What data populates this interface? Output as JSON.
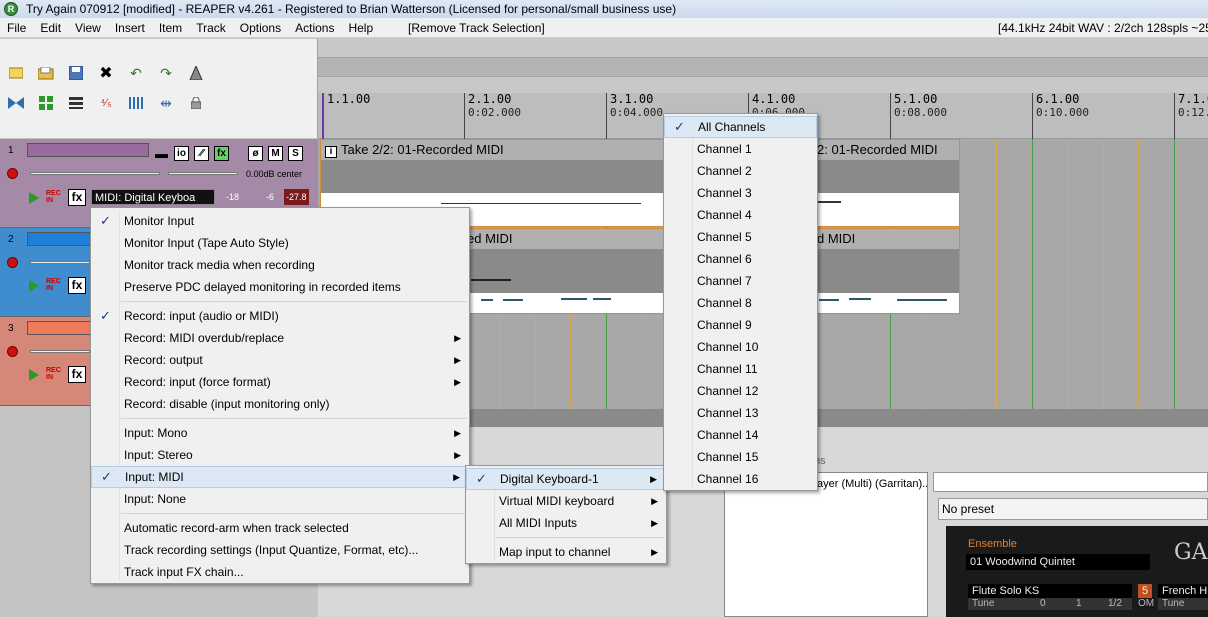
{
  "window": {
    "title": "Try Again 070912 [modified] - REAPER v4.261 - Registered to Brian Watterson (Licensed for personal/small business use)"
  },
  "menubar": {
    "items": [
      "File",
      "Edit",
      "View",
      "Insert",
      "Item",
      "Track",
      "Options",
      "Actions",
      "Help"
    ],
    "last_action": "[Remove Track Selection]",
    "status": "[44.1kHz 24bit WAV : 2/2ch 128spls ~25/"
  },
  "toolbar": {
    "icons": [
      "new-project-icon",
      "open-project-icon",
      "save-icon",
      "project-settings-icon",
      "undo-icon",
      "redo-icon",
      "metronome-icon",
      "ripple-icon",
      "grid-icon",
      "envelope-icon",
      "item-lock-icon",
      "snap-icon",
      "split-icon",
      "lock-icon"
    ]
  },
  "ruler": {
    "marks": [
      {
        "bar": "1.1.00",
        "time": ""
      },
      {
        "bar": "2.1.00",
        "time": "0:02.000"
      },
      {
        "bar": "3.1.00",
        "time": "0:04.000"
      },
      {
        "bar": "4.1.00",
        "time": "0:06.000"
      },
      {
        "bar": "5.1.00",
        "time": "0:08.000"
      },
      {
        "bar": "6.1.00",
        "time": "0:10.000"
      },
      {
        "bar": "7.1.0",
        "time": "0:12.0"
      }
    ]
  },
  "tracks": [
    {
      "number": "1",
      "color": "#a58aa8",
      "name_color": "#9a6c9e",
      "pan_label": "0.00dB center",
      "input": "MIDI: Digital Keyboa",
      "meter": [
        "-18",
        "-6",
        "-27.8"
      ]
    },
    {
      "number": "2",
      "color": "#3f8ccf",
      "name_color": "#1e7fd8"
    },
    {
      "number": "3",
      "color": "#d68878",
      "name_color": "#f07a5c"
    }
  ],
  "track_buttons": {
    "mute": "M",
    "solo": "S",
    "phase": "ø",
    "io": "io",
    "env": "⁄⁄",
    "fx": "fx",
    "rec_in": "REC\nIN"
  },
  "items": {
    "take_title": "Take 2/2: 01-Recorded MIDI",
    "take_title_right": "2: 01-Recorded MIDI",
    "track2_label_left": "ed MIDI",
    "track2_label_right": "d MIDI"
  },
  "track_menu": {
    "items": [
      {
        "label": "Monitor Input",
        "checked": true
      },
      {
        "label": "Monitor Input (Tape Auto Style)"
      },
      {
        "label": "Monitor track media when recording"
      },
      {
        "label": "Preserve PDC delayed monitoring in recorded items"
      },
      {
        "sep": true
      },
      {
        "label": "Record: input (audio or MIDI)",
        "checked": true
      },
      {
        "label": "Record: MIDI overdub/replace",
        "submenu": true
      },
      {
        "label": "Record: output",
        "submenu": true
      },
      {
        "label": "Record: input (force format)",
        "submenu": true
      },
      {
        "label": "Record: disable (input monitoring only)"
      },
      {
        "sep": true
      },
      {
        "label": "Input: Mono",
        "submenu": true
      },
      {
        "label": "Input: Stereo",
        "submenu": true
      },
      {
        "label": "Input: MIDI",
        "submenu": true,
        "checked": true,
        "highlight": true
      },
      {
        "label": "Input: None"
      },
      {
        "sep": true
      },
      {
        "label": "Automatic record-arm when track selected"
      },
      {
        "label": "Track recording settings (Input Quantize, Format, etc)..."
      },
      {
        "label": "Track input FX chain..."
      }
    ]
  },
  "midi_menu": {
    "items": [
      {
        "label": "Digital Keyboard-1",
        "submenu": true,
        "checked": true,
        "highlight": true
      },
      {
        "label": "Virtual MIDI keyboard",
        "submenu": true
      },
      {
        "label": "All MIDI Inputs",
        "submenu": true
      },
      {
        "sep": true
      },
      {
        "label": "Map input to channel",
        "submenu": true
      }
    ]
  },
  "channel_menu": {
    "items": [
      {
        "label": "All Channels",
        "checked": true,
        "highlight": true
      },
      {
        "label": "Channel 1"
      },
      {
        "label": "Channel 2"
      },
      {
        "label": "Channel 3"
      },
      {
        "label": "Channel 4"
      },
      {
        "label": "Channel 5"
      },
      {
        "label": "Channel 6"
      },
      {
        "label": "Channel 7"
      },
      {
        "label": "Channel 8"
      },
      {
        "label": "Channel 9"
      },
      {
        "label": "Channel 10"
      },
      {
        "label": "Channel 11"
      },
      {
        "label": "Channel 12"
      },
      {
        "label": "Channel 13"
      },
      {
        "label": "Channel 14"
      },
      {
        "label": "Channel 15"
      },
      {
        "label": "Channel 16"
      }
    ]
  },
  "fx_window": {
    "tab_fragment": "ns",
    "plugin": "ayer (Multi) (Garritan)...",
    "preset": "No preset",
    "ensemble_label": "Ensemble",
    "ensemble_value": "01 Woodwind Quintet",
    "brand_fragment": "GA",
    "slot1": "Flute Solo KS",
    "slot1_tune": "Tune",
    "slot1_vals": [
      "0",
      "1",
      "1/2",
      "OM"
    ],
    "slot2_num": "5",
    "slot2": "French H",
    "slot2_tune": "Tune"
  },
  "colors": {
    "accent_check": "#1a3a7a",
    "bar_line": "#4aa04a",
    "beat_line": "#d8a84a",
    "item_border": "#d08a40"
  }
}
